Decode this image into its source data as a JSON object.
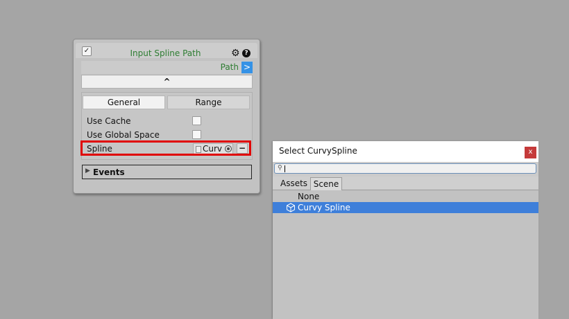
{
  "node": {
    "enabled_check": "✓",
    "title": "Input Spline Path",
    "gear_icon": "gear-icon",
    "help_icon": "?",
    "path_label": "Path",
    "path_button": ">",
    "collapse_glyph": "^",
    "tabs": [
      "General",
      "Range"
    ],
    "properties": [
      {
        "label": "Use Cache",
        "checked": false
      },
      {
        "label": "Use Global Space",
        "checked": false
      }
    ],
    "spline": {
      "label": "Spline",
      "value": "Curv",
      "remove_button": "−"
    },
    "events_label": "Events",
    "events_arrow": "▶"
  },
  "colors": {
    "title_green": "#2e7d32",
    "highlight_red": "#e00000",
    "selection_blue": "#3e7fda",
    "path_button_blue": "#3592e6"
  },
  "select_window": {
    "title": "Select CurvySpline",
    "close_label": "x",
    "search": {
      "value": "",
      "icon": "search-icon"
    },
    "tabs": [
      "Assets",
      "Scene"
    ],
    "active_tab": "Scene",
    "items": [
      {
        "label": "None",
        "selected": false
      },
      {
        "label": "Curvy Spline",
        "selected": true,
        "icon": "cube-icon"
      }
    ]
  }
}
